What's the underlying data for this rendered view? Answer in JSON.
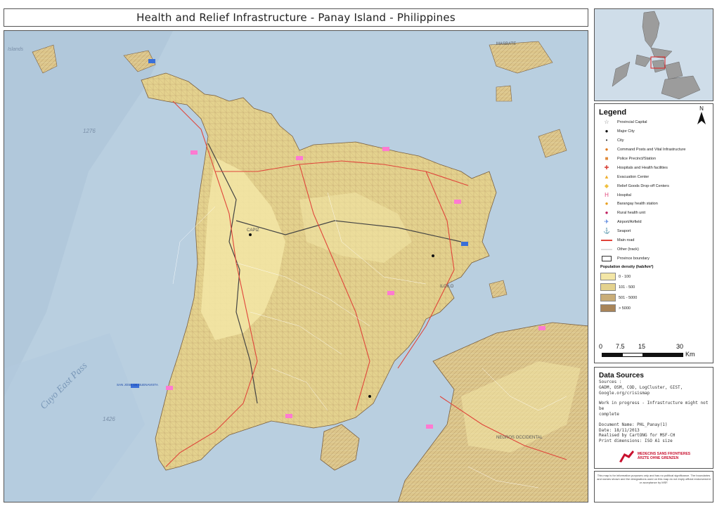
{
  "title": "Health and Relief Infrastructure - Panay Island - Philippines",
  "legend": {
    "heading": "Legend",
    "north": "N",
    "items": [
      {
        "label": "Provincial Capital",
        "symbol": "☆",
        "color": "#777777"
      },
      {
        "label": "Major City",
        "symbol": "●",
        "color": "#111111"
      },
      {
        "label": "City",
        "symbol": "•",
        "color": "#333333"
      },
      {
        "label": "Command Posts and Vital Infrastructure",
        "symbol": "●",
        "color": "#e07a1e"
      },
      {
        "label": "Police Precinct/Station",
        "symbol": "■",
        "color": "#e08a3a"
      },
      {
        "label": "Hospitals and Health facilities",
        "symbol": "✚",
        "color": "#d9443a"
      },
      {
        "label": "Evacuation Center",
        "symbol": "▲",
        "color": "#f0b030"
      },
      {
        "label": "Relief Goods Drop-off Centers",
        "symbol": "◆",
        "color": "#f0c040"
      },
      {
        "label": "Hospital",
        "symbol": "H",
        "color": "#e0457a"
      },
      {
        "label": "Barangay health station",
        "symbol": "●",
        "color": "#e8a020"
      },
      {
        "label": "Rural health unit",
        "symbol": "●",
        "color": "#c02060"
      },
      {
        "label": "Airport/Airfield",
        "symbol": "✈",
        "color": "#3a6fd8"
      },
      {
        "label": "Seaport",
        "symbol": "⚓",
        "color": "#888888"
      },
      {
        "label": "Main road",
        "symbol": "line",
        "color": "#e0443a"
      },
      {
        "label": "Other (track)",
        "symbol": "line",
        "color": "#dddddd"
      },
      {
        "label": "Province boundary",
        "symbol": "box",
        "color": "#333333"
      }
    ],
    "density_title": "Population density (hab/km²)",
    "density": [
      {
        "label": "0 - 100",
        "color": "#f3e6a6"
      },
      {
        "label": "101 - 500",
        "color": "#e4d28e"
      },
      {
        "label": "501 - 5000",
        "color": "#c9ad78"
      },
      {
        "label": "> 5000",
        "color": "#a88458"
      }
    ]
  },
  "scale": {
    "ticks": [
      "0",
      "7.5",
      "15",
      "30"
    ],
    "unit": "Km"
  },
  "sources": {
    "heading": "Data Sources",
    "lines": [
      "Sources :",
      "GADM, OSM, COD, LogCluster, GIST,",
      "Google.org/crisismap",
      "",
      "Work in progress - Infrastructure might not be",
      "complete",
      "",
      "Document Name: PHL_Panay(1)",
      "Date: 18/11/2013",
      "Realised by CartONG for MSF-CH",
      "Print dimensions: ISO A1 size"
    ]
  },
  "msf": {
    "line1": "MEDECINS SANS FRONTIERES",
    "line2": "ÄRZTE OHNE GRENZEN"
  },
  "disclaimer": "This map is for information purposes only and has no political significance. The boundaries and names shown and the designations used on this map do not imply official endorsement or acceptance by MSF.",
  "map_labels": {
    "sea1": "1276",
    "sea2": "1426",
    "pass": "Cuyo East Pass",
    "capiz": "CAPIZ",
    "iloilo": "ILOILO",
    "negros": "NEGROS OCCIDENTAL",
    "masbate": "MASBATE",
    "islands": "Islands",
    "san_jose": "SAN JOSE DE BUENAVISTA"
  },
  "colors": {
    "sea": "#b9cfe0",
    "land_low": "#f3e6a6",
    "land_mid": "#e4d28e",
    "land_high": "#c9ad78",
    "road": "#e0443a"
  }
}
